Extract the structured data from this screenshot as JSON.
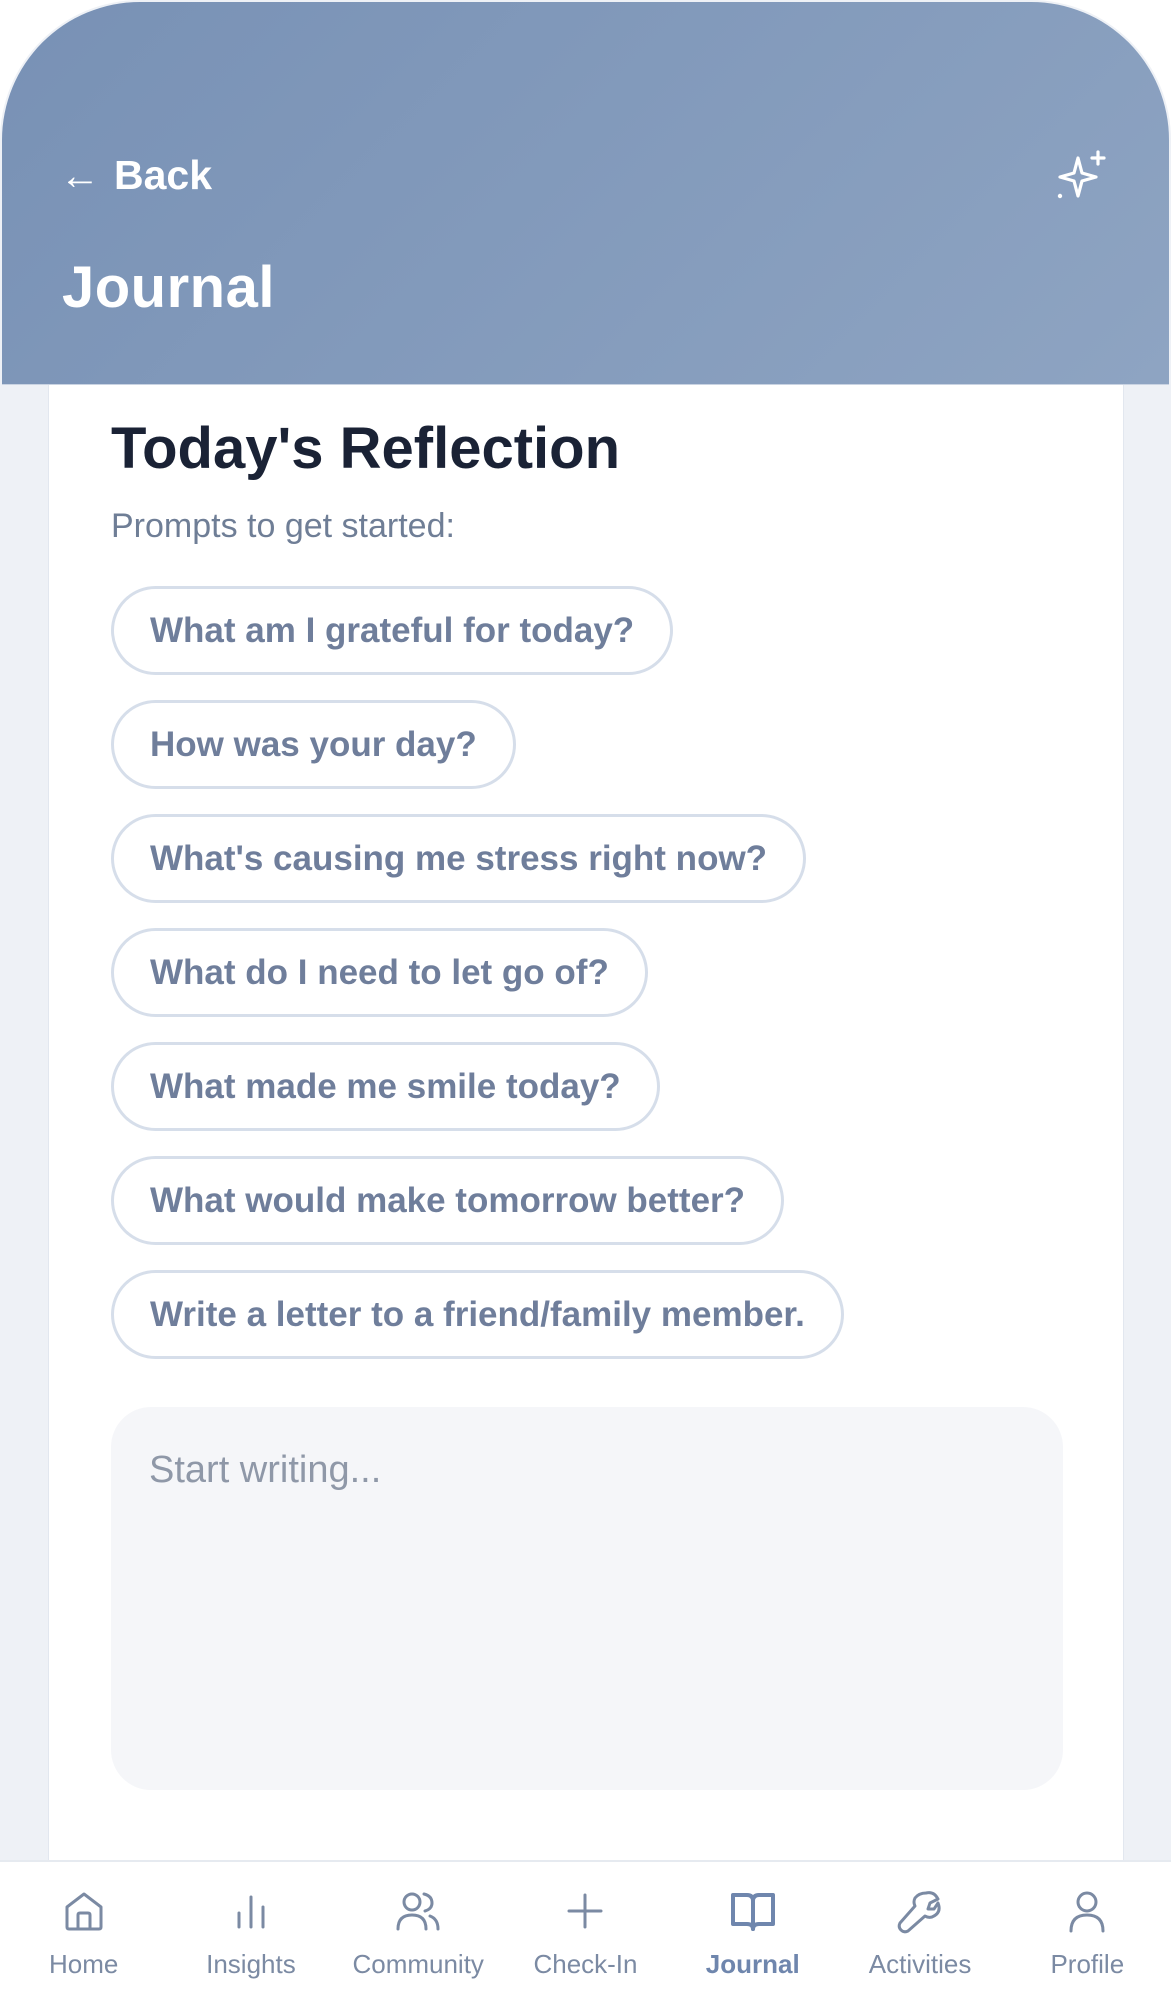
{
  "header": {
    "back_label": "Back",
    "back_arrow": "←",
    "title": "Journal",
    "action_icon": "sparkle-icon"
  },
  "reflection": {
    "title": "Today's Reflection",
    "prompts_label": "Prompts to get started:",
    "prompts": [
      "What am I grateful for today?",
      "How was your day?",
      "What's causing me stress right now?",
      "What do I need to let go of?",
      "What made me smile today?",
      "What would make tomorrow better?",
      "Write a letter to a friend/family member."
    ],
    "editor": {
      "placeholder": "Start writing...",
      "value": ""
    }
  },
  "nav": {
    "items": [
      {
        "label": "Home",
        "icon": "home-icon",
        "active": false
      },
      {
        "label": "Insights",
        "icon": "bar-chart-icon",
        "active": false
      },
      {
        "label": "Community",
        "icon": "users-icon",
        "active": false
      },
      {
        "label": "Check-In",
        "icon": "plus-icon",
        "active": false
      },
      {
        "label": "Journal",
        "icon": "book-open-icon",
        "active": true
      },
      {
        "label": "Activities",
        "icon": "wrench-icon",
        "active": false
      },
      {
        "label": "Profile",
        "icon": "user-icon",
        "active": false
      }
    ]
  },
  "colors": {
    "header_gradient_start": "#7891b5",
    "header_gradient_end": "#8ea4c2",
    "nav_active": "#6f86ad",
    "nav_inactive": "#7b8aa3"
  }
}
